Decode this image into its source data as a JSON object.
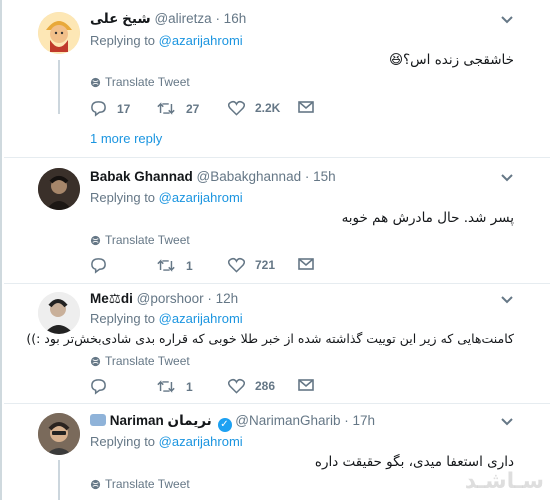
{
  "tweets": [
    {
      "name": "شیخ علی",
      "handle": "@aliretza",
      "time": "· 16h",
      "replying_label": "Replying to ",
      "replying_to": "@azarijahromi",
      "text": "خاشقجی زنده اس؟😆",
      "translate": "Translate Tweet",
      "replies": "17",
      "retweets": "27",
      "likes": "2.2K",
      "more_replies": "1 more reply"
    },
    {
      "name": "Babak Ghannad",
      "handle": "@Babakghannad",
      "time": "· 15h",
      "replying_label": "Replying to ",
      "replying_to": "@azarijahromi",
      "text": "پسر شد. حال مادرش هم خوبه",
      "translate": "Translate Tweet",
      "replies": "",
      "retweets": "1",
      "likes": "721"
    },
    {
      "name": "Me⚖di",
      "handle": "@porshoor",
      "time": "· 12h",
      "replying_label": "Replying to ",
      "replying_to": "@azarijahromi",
      "text": "کامنت‌هایی که زیر این توییت گذاشته شده از خبر طلا خوبی که قراره بدی شادی‌بخش‌تر بود :))",
      "translate": "Translate Tweet",
      "replies": "",
      "retweets": "1",
      "likes": "286"
    },
    {
      "name": "Nariman نریمان",
      "handle": "@NarimanGharib",
      "time": "· 17h",
      "replying_label": "Replying to ",
      "replying_to": "@azarijahromi",
      "text": "داری استعفا میدی، بگو حقیقت داره",
      "translate": "Translate Tweet"
    }
  ],
  "watermark": "سـاشـد",
  "colors": {
    "link": "#1b95e0",
    "muted": "#657786",
    "border": "#e6ecf0"
  }
}
